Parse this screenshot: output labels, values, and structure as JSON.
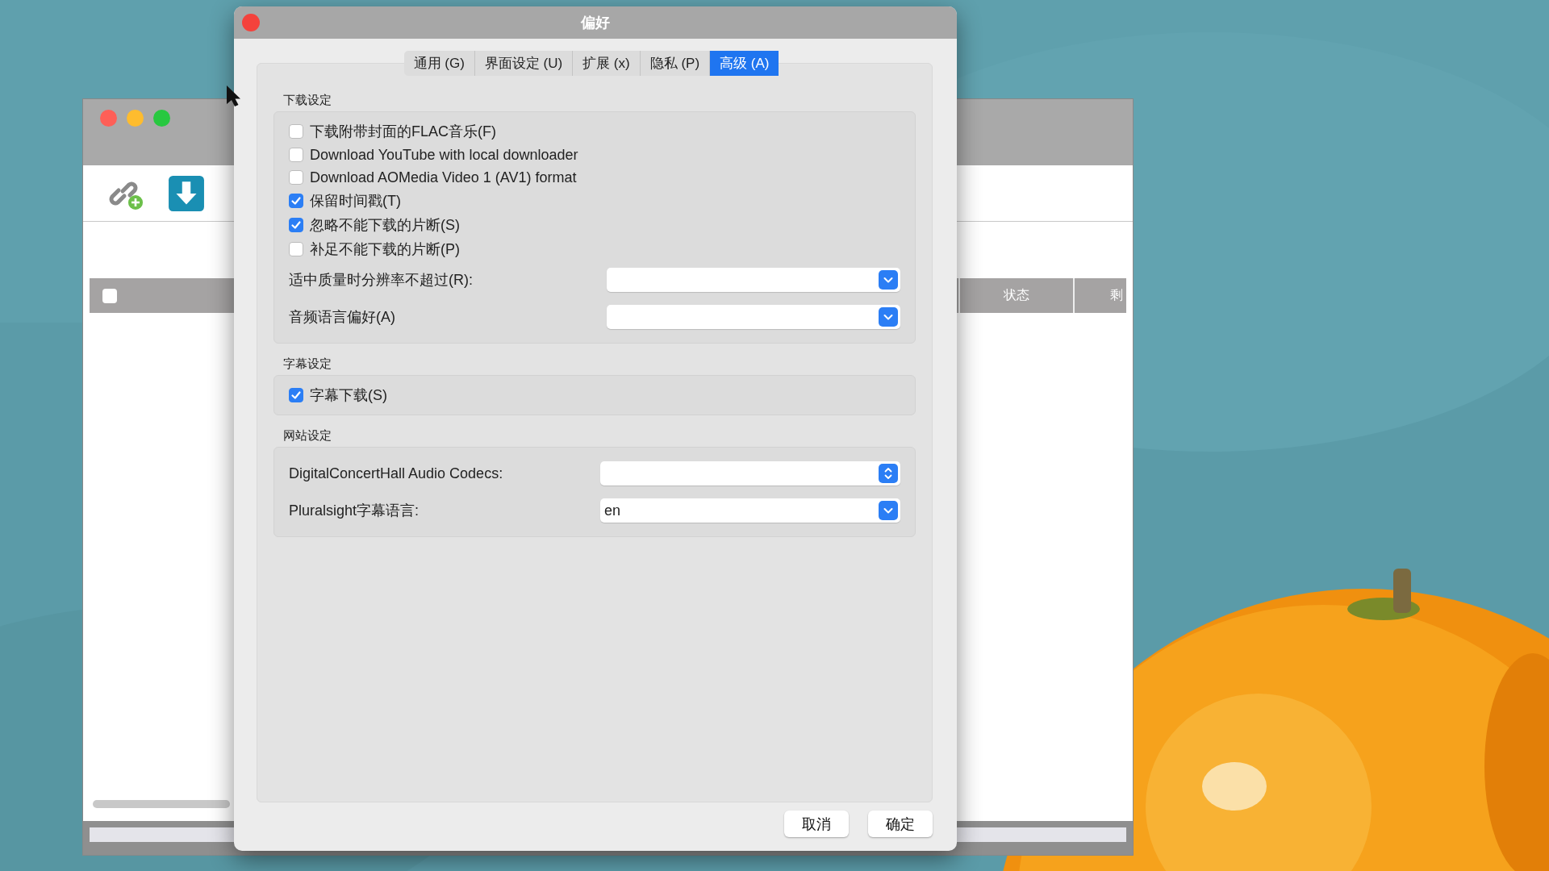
{
  "background_window": {
    "table_header": {
      "checked": false,
      "columns": [
        "状态",
        "剩"
      ]
    }
  },
  "dialog": {
    "title": "偏好",
    "tabs": [
      {
        "label": "通用 (G)",
        "selected": false
      },
      {
        "label": "界面设定 (U)",
        "selected": false
      },
      {
        "label": "扩展 (x)",
        "selected": false
      },
      {
        "label": "隐私 (P)",
        "selected": false
      },
      {
        "label": "高级 (A)",
        "selected": true
      }
    ],
    "sections": [
      {
        "title": "下载设定",
        "rows": [
          {
            "kind": "checkbox",
            "label": "下载附带封面的FLAC音乐(F)",
            "checked": false
          },
          {
            "kind": "checkbox",
            "label": "Download YouTube with local downloader",
            "checked": false
          },
          {
            "kind": "checkbox",
            "label": "Download AOMedia Video 1 (AV1) format",
            "checked": false
          },
          {
            "kind": "checkbox",
            "label": "保留时间戳(T)",
            "checked": true
          },
          {
            "kind": "checkbox",
            "label": "忽略不能下载的片断(S)",
            "checked": true
          },
          {
            "kind": "checkbox",
            "label": "补足不能下载的片断(P)",
            "checked": false
          },
          {
            "kind": "dropdown",
            "label": "适中质量时分辨率不超过(R):"
          },
          {
            "kind": "dropdown",
            "label": "音频语言偏好(A)"
          }
        ]
      },
      {
        "title": "字幕设定",
        "rows": [
          {
            "kind": "checkbox",
            "label": "字幕下载(S)",
            "checked": true
          }
        ]
      },
      {
        "title": "网站设定",
        "rows": [
          {
            "kind": "popup",
            "label": "DigitalConcertHall Audio Codecs:"
          },
          {
            "kind": "dropdown",
            "label": "Pluralsight字幕语言:",
            "value": "en"
          }
        ]
      }
    ],
    "buttons": [
      "取消",
      "确定"
    ]
  }
}
